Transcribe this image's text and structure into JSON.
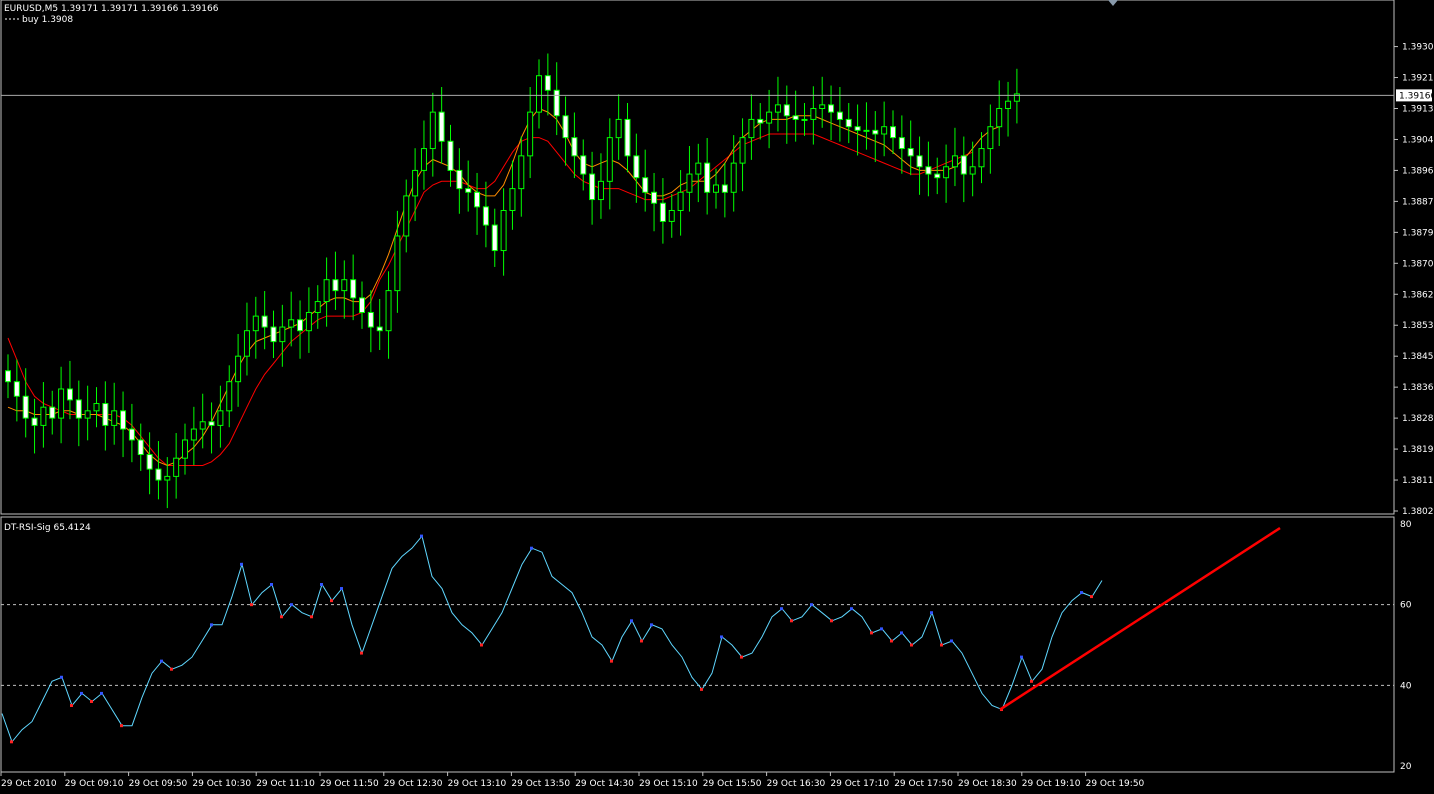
{
  "main_chart": {
    "symbol_info": "EURUSD,M5  1.39171 1.39171 1.39166 1.39166",
    "order_label": "buy 1.3908",
    "current_price_label": "1.39166",
    "current_price": 1.39166,
    "ylim": [
      1.38025,
      1.3934
    ],
    "price_ticks": [
      "1.39300",
      "1.39215",
      "1.39130",
      "1.39045",
      "1.38960",
      "1.38875",
      "1.38790",
      "1.38705",
      "1.38620",
      "1.38535",
      "1.38450",
      "1.38365",
      "1.38280",
      "1.38195",
      "1.38110",
      "1.38025"
    ]
  },
  "indicator": {
    "label": "DT-RSI-Sig 65.4124",
    "ylim": [
      20,
      80
    ],
    "ticks": [
      "80",
      "60",
      "40",
      "20"
    ],
    "levels": [
      60,
      40
    ]
  },
  "time_axis": {
    "labels": [
      "29 Oct 2010",
      "29 Oct 09:10",
      "29 Oct 09:50",
      "29 Oct 10:30",
      "29 Oct 11:10",
      "29 Oct 11:50",
      "29 Oct 12:30",
      "29 Oct 13:10",
      "29 Oct 13:50",
      "29 Oct 14:30",
      "29 Oct 15:10",
      "29 Oct 15:50",
      "29 Oct 16:30",
      "29 Oct 17:10",
      "29 Oct 17:50",
      "29 Oct 18:30",
      "29 Oct 19:10",
      "29 Oct 19:50"
    ]
  },
  "chart_data": {
    "type": "line",
    "close_prices": [
      1.3838,
      1.3834,
      1.3828,
      1.3826,
      1.3831,
      1.3828,
      1.3836,
      1.3833,
      1.3828,
      1.383,
      1.3832,
      1.3826,
      1.383,
      1.3825,
      1.3822,
      1.3818,
      1.3814,
      1.3811,
      1.3812,
      1.3817,
      1.3822,
      1.3825,
      1.3827,
      1.3826,
      1.383,
      1.3838,
      1.3845,
      1.3852,
      1.3856,
      1.3853,
      1.3849,
      1.3853,
      1.3855,
      1.3852,
      1.3857,
      1.386,
      1.3866,
      1.3863,
      1.3866,
      1.3861,
      1.3857,
      1.3853,
      1.3852,
      1.3863,
      1.3878,
      1.3889,
      1.3896,
      1.3902,
      1.3912,
      1.3904,
      1.3896,
      1.3891,
      1.389,
      1.3886,
      1.3881,
      1.3874,
      1.3885,
      1.3891,
      1.39,
      1.3912,
      1.3922,
      1.3918,
      1.3911,
      1.3905,
      1.39,
      1.3895,
      1.3888,
      1.3893,
      1.3905,
      1.391,
      1.39,
      1.3894,
      1.389,
      1.3887,
      1.3882,
      1.3885,
      1.389,
      1.3895,
      1.3898,
      1.389,
      1.3892,
      1.389,
      1.3898,
      1.3905,
      1.391,
      1.3909,
      1.3912,
      1.3914,
      1.3911,
      1.391,
      1.391,
      1.3913,
      1.3914,
      1.3912,
      1.391,
      1.3908,
      1.3907,
      1.3907,
      1.3906,
      1.3908,
      1.3905,
      1.3902,
      1.39,
      1.3897,
      1.3895,
      1.3894,
      1.3897,
      1.39,
      1.3895,
      1.3897,
      1.3902,
      1.3908,
      1.3913,
      1.3915,
      1.3917
    ],
    "fast_ma": [
      1.3831,
      1.383,
      1.383,
      1.3829,
      1.3829,
      1.3829,
      1.383,
      1.383,
      1.3829,
      1.3829,
      1.3829,
      1.3828,
      1.3827,
      1.3826,
      1.3824,
      1.3821,
      1.3818,
      1.3816,
      1.3815,
      1.3816,
      1.3818,
      1.382,
      1.3823,
      1.3827,
      1.3832,
      1.3837,
      1.3842,
      1.3846,
      1.3849,
      1.385,
      1.3851,
      1.3852,
      1.3853,
      1.3854,
      1.3856,
      1.3858,
      1.386,
      1.3861,
      1.3861,
      1.386,
      1.386,
      1.3862,
      1.3867,
      1.3873,
      1.388,
      1.3887,
      1.3893,
      1.3897,
      1.3899,
      1.3898,
      1.3897,
      1.3895,
      1.3892,
      1.389,
      1.3889,
      1.3889,
      1.3892,
      1.3898,
      1.3905,
      1.391,
      1.3913,
      1.3912,
      1.391,
      1.3906,
      1.3901,
      1.3898,
      1.3897,
      1.3898,
      1.3899,
      1.3898,
      1.3896,
      1.3893,
      1.389,
      1.3889,
      1.3889,
      1.389,
      1.3892,
      1.3893,
      1.3893,
      1.3893,
      1.3895,
      1.3898,
      1.3902,
      1.3905,
      1.3907,
      1.3909,
      1.391,
      1.391,
      1.391,
      1.3911,
      1.3911,
      1.3911,
      1.391,
      1.3909,
      1.3908,
      1.3907,
      1.3906,
      1.3905,
      1.3904,
      1.3903,
      1.3901,
      1.3899,
      1.3897,
      1.3896,
      1.3896,
      1.3896,
      1.3896,
      1.3897,
      1.3899,
      1.3902,
      1.3905,
      1.3907,
      1.3908
    ],
    "slow_ma": [
      1.385,
      1.3844,
      1.3838,
      1.3834,
      1.3832,
      1.3831,
      1.383,
      1.3829,
      1.3829,
      1.3829,
      1.3829,
      1.3829,
      1.3829,
      1.3828,
      1.3826,
      1.3823,
      1.382,
      1.3817,
      1.3815,
      1.3815,
      1.3815,
      1.3815,
      1.3815,
      1.3816,
      1.3818,
      1.3821,
      1.3826,
      1.3831,
      1.3836,
      1.384,
      1.3843,
      1.3846,
      1.3849,
      1.3851,
      1.3853,
      1.3855,
      1.3856,
      1.3856,
      1.3856,
      1.3856,
      1.3857,
      1.386,
      1.3866,
      1.387,
      1.3875,
      1.388,
      1.3885,
      1.389,
      1.3892,
      1.3893,
      1.3893,
      1.3893,
      1.3892,
      1.3891,
      1.3891,
      1.3893,
      1.3897,
      1.3901,
      1.3904,
      1.3905,
      1.3905,
      1.3904,
      1.3901,
      1.3898,
      1.3895,
      1.3893,
      1.3892,
      1.3891,
      1.3891,
      1.3891,
      1.389,
      1.3889,
      1.3888,
      1.3888,
      1.3888,
      1.3889,
      1.389,
      1.3891,
      1.3893,
      1.3895,
      1.3897,
      1.3899,
      1.3901,
      1.3903,
      1.3904,
      1.3905,
      1.3906,
      1.3906,
      1.3906,
      1.3906,
      1.3906,
      1.3906,
      1.3905,
      1.3904,
      1.3903,
      1.3902,
      1.3901,
      1.39,
      1.3899,
      1.3898,
      1.3897,
      1.3896,
      1.3895,
      1.3895,
      1.3896,
      1.3897,
      1.3898,
      1.3899,
      1.39,
      1.3901
    ],
    "rsi_points": [
      [
        0,
        33
      ],
      [
        10,
        26
      ],
      [
        20,
        29
      ],
      [
        30,
        31
      ],
      [
        40,
        36
      ],
      [
        50,
        41
      ],
      [
        60,
        42
      ],
      [
        70,
        35
      ],
      [
        80,
        38
      ],
      [
        90,
        36
      ],
      [
        100,
        38
      ],
      [
        110,
        34
      ],
      [
        120,
        30
      ],
      [
        130,
        30
      ],
      [
        140,
        37
      ],
      [
        150,
        43
      ],
      [
        160,
        46
      ],
      [
        170,
        44
      ],
      [
        180,
        45
      ],
      [
        190,
        47
      ],
      [
        200,
        51
      ],
      [
        210,
        55
      ],
      [
        220,
        55
      ],
      [
        230,
        62
      ],
      [
        240,
        70
      ],
      [
        250,
        60
      ],
      [
        260,
        63
      ],
      [
        270,
        65
      ],
      [
        280,
        57
      ],
      [
        290,
        60
      ],
      [
        300,
        58
      ],
      [
        310,
        57
      ],
      [
        320,
        65
      ],
      [
        330,
        61
      ],
      [
        340,
        64
      ],
      [
        350,
        55
      ],
      [
        360,
        48
      ],
      [
        370,
        55
      ],
      [
        380,
        62
      ],
      [
        390,
        69
      ],
      [
        400,
        72
      ],
      [
        410,
        74
      ],
      [
        420,
        77
      ],
      [
        430,
        67
      ],
      [
        440,
        64
      ],
      [
        450,
        58
      ],
      [
        460,
        55
      ],
      [
        470,
        53
      ],
      [
        480,
        50
      ],
      [
        490,
        54
      ],
      [
        500,
        58
      ],
      [
        510,
        64
      ],
      [
        520,
        70
      ],
      [
        530,
        74
      ],
      [
        540,
        73
      ],
      [
        550,
        67
      ],
      [
        560,
        65
      ],
      [
        570,
        63
      ],
      [
        580,
        58
      ],
      [
        590,
        52
      ],
      [
        600,
        50
      ],
      [
        610,
        46
      ],
      [
        620,
        52
      ],
      [
        630,
        56
      ],
      [
        640,
        51
      ],
      [
        650,
        55
      ],
      [
        660,
        54
      ],
      [
        670,
        50
      ],
      [
        680,
        47
      ],
      [
        690,
        42
      ],
      [
        700,
        39
      ],
      [
        710,
        43
      ],
      [
        720,
        52
      ],
      [
        730,
        50
      ],
      [
        740,
        47
      ],
      [
        750,
        48
      ],
      [
        760,
        52
      ],
      [
        770,
        57
      ],
      [
        780,
        59
      ],
      [
        790,
        56
      ],
      [
        800,
        57
      ],
      [
        810,
        60
      ],
      [
        820,
        58
      ],
      [
        830,
        56
      ],
      [
        840,
        57
      ],
      [
        850,
        59
      ],
      [
        860,
        57
      ],
      [
        870,
        53
      ],
      [
        880,
        54
      ],
      [
        890,
        51
      ],
      [
        900,
        53
      ],
      [
        910,
        50
      ],
      [
        920,
        52
      ],
      [
        930,
        58
      ],
      [
        940,
        50
      ],
      [
        950,
        51
      ],
      [
        960,
        48
      ],
      [
        970,
        43
      ],
      [
        980,
        38
      ],
      [
        990,
        35
      ],
      [
        1000,
        34
      ],
      [
        1010,
        40
      ],
      [
        1020,
        47
      ],
      [
        1030,
        41
      ],
      [
        1040,
        44
      ],
      [
        1050,
        52
      ],
      [
        1060,
        58
      ],
      [
        1070,
        61
      ],
      [
        1080,
        63
      ],
      [
        1090,
        62
      ],
      [
        1100,
        66
      ]
    ],
    "trendline": {
      "from": [
        1000,
        34
      ],
      "to": [
        1280,
        79
      ]
    }
  },
  "colors": {
    "background": "#000000",
    "candle": "#00ff00",
    "fast_ma": "#ff8c00",
    "slow_ma": "#ff0000",
    "rsi_line": "#5fd7ff",
    "trendline": "#ff0000",
    "grid": "#c0c0c0"
  }
}
